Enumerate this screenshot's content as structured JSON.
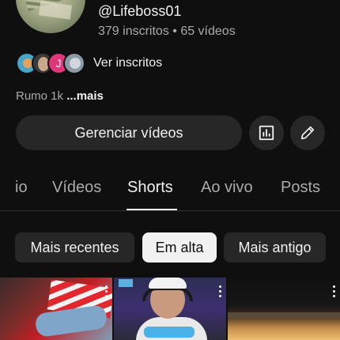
{
  "channel": {
    "handle": "@Lifeboss01",
    "stats": "379 inscritos • 65 vídeos",
    "subscribers_link": "Ver inscritos",
    "mini_avatar_letter": "J",
    "description_prefix": "Rumo 1k ",
    "description_more": "...mais"
  },
  "actions": {
    "manage_label": "Gerenciar vídeos",
    "stats_icon": "analytics-icon",
    "edit_icon": "pencil-icon"
  },
  "tabs": [
    {
      "label": "io"
    },
    {
      "label": "Vídeos"
    },
    {
      "label": "Shorts"
    },
    {
      "label": "Ao vivo"
    },
    {
      "label": "Posts"
    }
  ],
  "active_tab": "Shorts",
  "chips": [
    {
      "label": "Mais recentes"
    },
    {
      "label": "Em alta"
    },
    {
      "label": "Mais antigo"
    }
  ],
  "active_chip": "Em alta",
  "colors": {
    "background": "#0f0f0f",
    "surface": "#272727",
    "text_primary": "#f1f1f1",
    "text_secondary": "#aaaaaa"
  }
}
